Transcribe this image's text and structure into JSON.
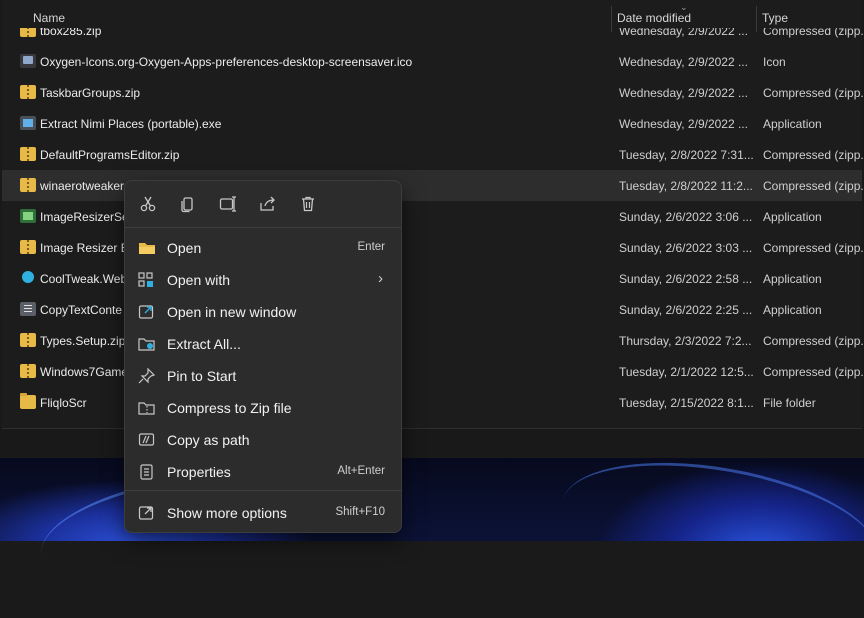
{
  "columns": {
    "name": "Name",
    "date": "Date modified",
    "type": "Type"
  },
  "files": [
    {
      "name": "tbox285.zip",
      "date": "Wednesday, 2/9/2022 ...",
      "type": "Compressed (zipp...",
      "icon": "zip-icon"
    },
    {
      "name": "Oxygen-Icons.org-Oxygen-Apps-preferences-desktop-screensaver.ico",
      "date": "Wednesday, 2/9/2022 ...",
      "type": "Icon",
      "icon": "ico-file-icon"
    },
    {
      "name": "TaskbarGroups.zip",
      "date": "Wednesday, 2/9/2022 ...",
      "type": "Compressed (zipp...",
      "icon": "zip-icon"
    },
    {
      "name": "Extract Nimi Places (portable).exe",
      "date": "Wednesday, 2/9/2022 ...",
      "type": "Application",
      "icon": "exe-icon"
    },
    {
      "name": "DefaultProgramsEditor.zip",
      "date": "Tuesday, 2/8/2022 7:31...",
      "type": "Compressed (zipp...",
      "icon": "zip-icon"
    },
    {
      "name": "winaerotweaker",
      "date": "Tuesday, 2/8/2022 11:2...",
      "type": "Compressed (zipp...",
      "icon": "zip-icon"
    },
    {
      "name": "ImageResizerSe",
      "date": "Sunday, 2/6/2022 3:06 ...",
      "type": "Application",
      "icon": "app-icon"
    },
    {
      "name": "Image Resizer Er",
      "date": "Sunday, 2/6/2022 3:03 ...",
      "type": "Compressed (zipp...",
      "icon": "zip-icon"
    },
    {
      "name": "CoolTweak.Web",
      "date": "Sunday, 2/6/2022 2:58 ...",
      "type": "Application",
      "icon": "app-icon"
    },
    {
      "name": "CopyTextConte",
      "date": "Sunday, 2/6/2022 2:25 ...",
      "type": "Application",
      "icon": "app-icon"
    },
    {
      "name": "Types.Setup.zip",
      "date": "Thursday, 2/3/2022 7:2...",
      "type": "Compressed (zipp...",
      "icon": "zip-icon"
    },
    {
      "name": "Windows7Game",
      "date": "Tuesday, 2/1/2022 12:5...",
      "type": "Compressed (zipp...",
      "icon": "zip-icon"
    },
    {
      "name": "FliqloScr",
      "date": "Tuesday, 2/15/2022 8:1...",
      "type": "File folder",
      "icon": "folder-icon"
    }
  ],
  "context_menu": {
    "toolbar": [
      "cut-icon",
      "copy-icon",
      "rename-icon",
      "share-icon",
      "delete-icon"
    ],
    "items": [
      {
        "label": "Open",
        "shortcut": "Enter",
        "icon": "folder-open-icon"
      },
      {
        "label": "Open with",
        "shortcut": "",
        "icon": "open-with-icon",
        "submenu": true
      },
      {
        "label": "Open in new window",
        "shortcut": "",
        "icon": "new-window-icon"
      },
      {
        "label": "Extract All...",
        "shortcut": "",
        "icon": "extract-icon"
      },
      {
        "label": "Pin to Start",
        "shortcut": "",
        "icon": "pin-icon"
      },
      {
        "label": "Compress to Zip file",
        "shortcut": "",
        "icon": "zip-compress-icon"
      },
      {
        "label": "Copy as path",
        "shortcut": "",
        "icon": "copy-path-icon"
      },
      {
        "label": "Properties",
        "shortcut": "Alt+Enter",
        "icon": "properties-icon"
      },
      {
        "label": "Show more options",
        "shortcut": "Shift+F10",
        "icon": "more-options-icon"
      }
    ]
  },
  "colors": {
    "folder": "#e7b947",
    "accent": "#2fb0e0",
    "menu_bg": "#2c2c2c",
    "selected_row": "#2d2d2d"
  }
}
